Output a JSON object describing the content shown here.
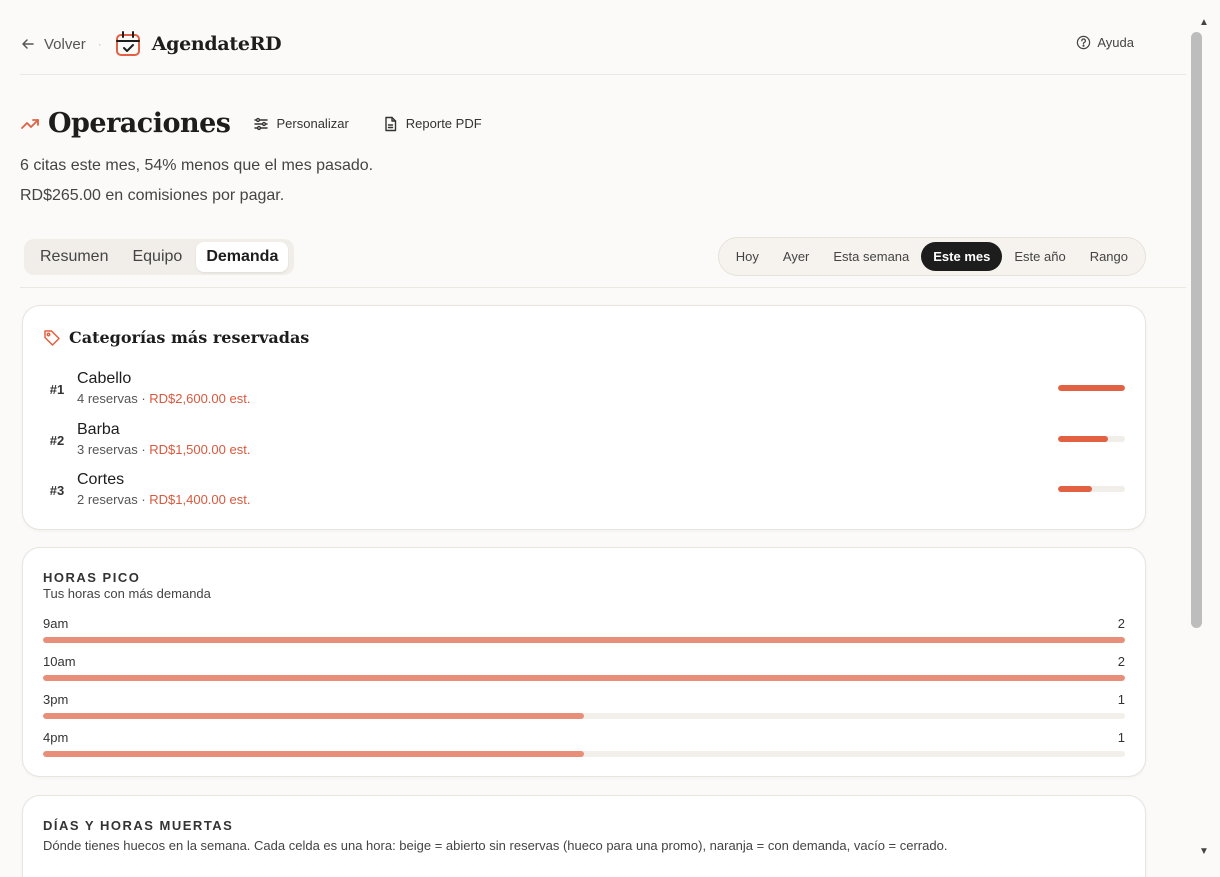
{
  "topbar": {
    "back_label": "Volver",
    "separator": "·",
    "brand_name": "AgendateRD",
    "help_label": "Ayuda"
  },
  "header": {
    "title": "Operaciones",
    "customize_label": "Personalizar",
    "report_label": "Reporte PDF",
    "summary_line1": "6 citas este mes, 54% menos que el mes pasado.",
    "summary_line2": "RD$265.00 en comisiones por pagar."
  },
  "tabs": [
    {
      "label": "Resumen",
      "active": false
    },
    {
      "label": "Equipo",
      "active": false
    },
    {
      "label": "Demanda",
      "active": true
    }
  ],
  "ranges": [
    {
      "label": "Hoy",
      "active": false
    },
    {
      "label": "Ayer",
      "active": false
    },
    {
      "label": "Esta semana",
      "active": false
    },
    {
      "label": "Este mes",
      "active": true
    },
    {
      "label": "Este año",
      "active": false
    },
    {
      "label": "Rango",
      "active": false
    }
  ],
  "categories": {
    "title": "Categorías más reservadas",
    "items": [
      {
        "rank": "#1",
        "name": "Cabello",
        "bookings": "4 reservas",
        "amount": "RD$2,600.00 est.",
        "share": 1.0
      },
      {
        "rank": "#2",
        "name": "Barba",
        "bookings": "3 reservas",
        "amount": "RD$1,500.00 est.",
        "share": 0.75
      },
      {
        "rank": "#3",
        "name": "Cortes",
        "bookings": "2 reservas",
        "amount": "RD$1,400.00 est.",
        "share": 0.5
      }
    ]
  },
  "peak_hours": {
    "label": "Horas pico",
    "description": "Tus horas con más demanda",
    "max": 2,
    "items": [
      {
        "hour": "9am",
        "value": 2
      },
      {
        "hour": "10am",
        "value": 2
      },
      {
        "hour": "3pm",
        "value": 1
      },
      {
        "hour": "4pm",
        "value": 1
      }
    ]
  },
  "dead_hours": {
    "label": "Días y horas muertas",
    "description": "Dónde tienes huecos en la semana. Cada celda es una hora: beige = abierto sin reservas (hueco para una promo), naranja = con demanda, vacío = cerrado."
  },
  "colors": {
    "accent": "#e26142",
    "accent_light": "#e98e78",
    "amount_text": "#d9593d",
    "active_range_bg": "#1d1d1d"
  }
}
